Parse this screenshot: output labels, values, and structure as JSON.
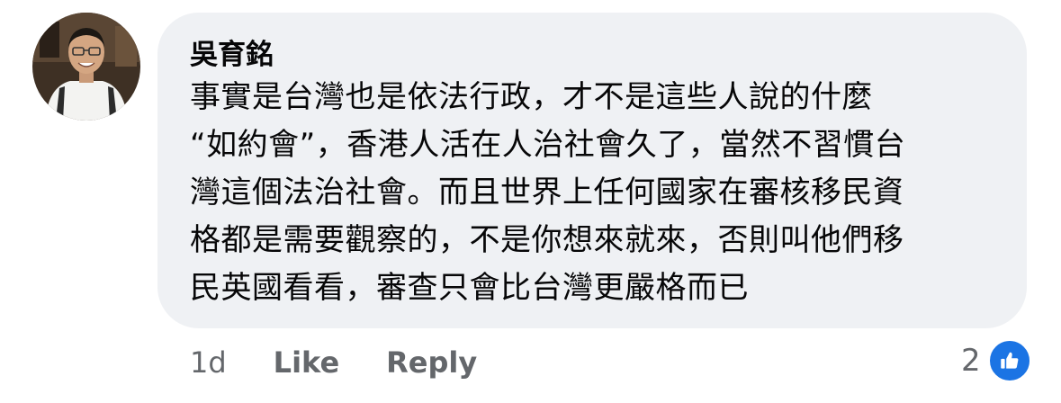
{
  "comment": {
    "author": "吳育銘",
    "text_lines": [
      "事實是台灣也是依法行政，才不是這些人說的什麼",
      "“如約會”，香港人活在人治社會久了，當然不習慣台",
      "灣這個法治社會。而且世界上任何國家在審核移民資",
      "格都是需要觀察的，不是你想來就來，否則叫他們移",
      "民英國看看，審查只會比台灣更嚴格而已"
    ],
    "avatar_icon": "profile-photo",
    "colors": {
      "bubble": "#eff1f4",
      "text": "#070708",
      "meta": "#64676b",
      "like_blue": "#1b74e4"
    }
  },
  "actions": {
    "time": "1d",
    "like_label": "Like",
    "reply_label": "Reply"
  },
  "reactions": {
    "count": "2",
    "icon": "thumbs-up-icon"
  }
}
